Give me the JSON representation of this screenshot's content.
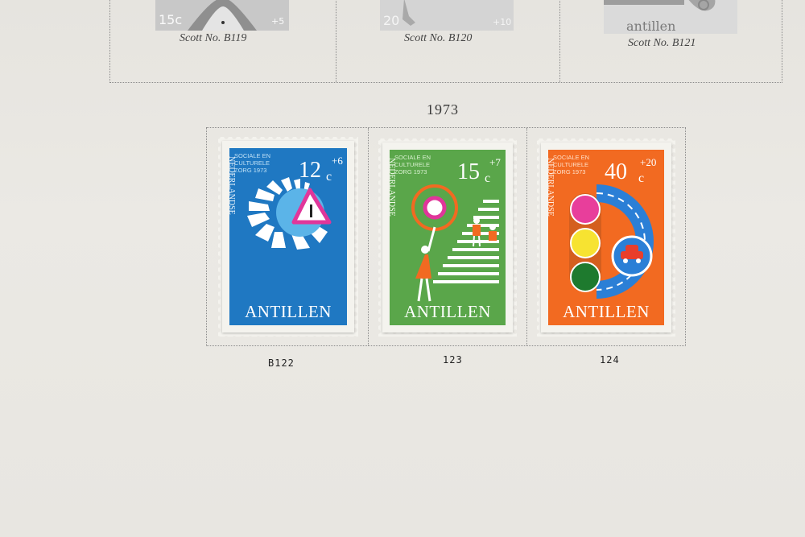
{
  "top_row": {
    "stamps": [
      {
        "label": "Scott No. B119",
        "value_left": "15c",
        "value_right": "+5"
      },
      {
        "label": "Scott No. B120",
        "value_left": "20",
        "value_right": "+10"
      },
      {
        "label": "Scott No. B121",
        "value_text": "antillen"
      }
    ]
  },
  "year": "1973",
  "stamps": [
    {
      "color": "#1f78c2",
      "header": [
        "SOCIALE EN",
        "CULTURELE",
        "ZORG 1973"
      ],
      "value_main": "12",
      "value_plus": "+6",
      "value_unit": "c",
      "side_text": "NEDERLANDSE",
      "country": "ANTILLEN",
      "note": "B122"
    },
    {
      "color": "#5aa64a",
      "header": [
        "SOCIALE EN",
        "CULTURELE",
        "ZORG 1973"
      ],
      "value_main": "15",
      "value_plus": "+7",
      "value_unit": "c",
      "side_text": "NEDERLANDSE",
      "country": "ANTILLEN",
      "note": "123"
    },
    {
      "color": "#f26a21",
      "header": [
        "SOCIALE EN",
        "CULTURELE",
        "ZORG 1973"
      ],
      "value_main": "40",
      "value_plus": "+20",
      "value_unit": "c",
      "side_text": "NEDERLANDSE",
      "country": "ANTILLEN",
      "note": "124"
    }
  ]
}
